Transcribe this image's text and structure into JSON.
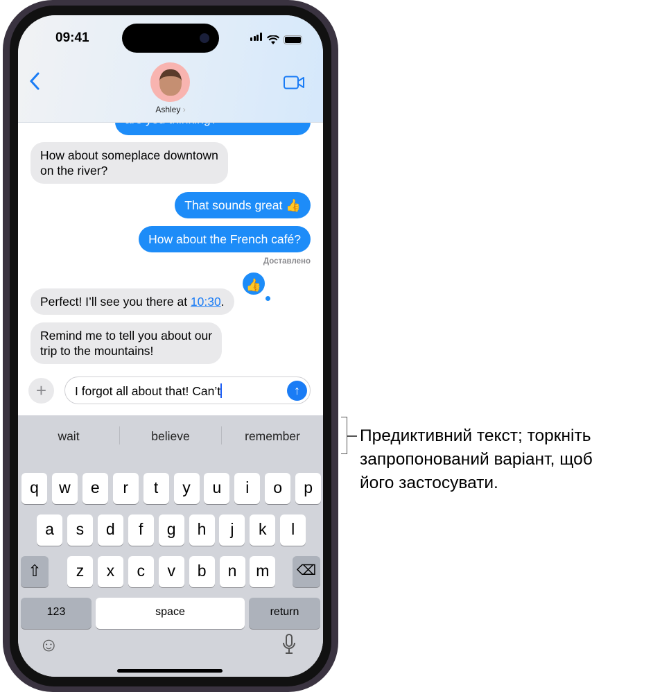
{
  "status_bar": {
    "time": "09:41"
  },
  "header": {
    "contact_name": "Ashley",
    "back_icon": "chevron-left-icon",
    "video_icon": "video-camera-icon"
  },
  "messages": [
    {
      "side": "out",
      "text": "are you thinking?"
    },
    {
      "side": "in",
      "lines": [
        "How about someplace downtown",
        "on the river?"
      ]
    },
    {
      "side": "out",
      "text": "That sounds great 👍"
    },
    {
      "side": "out",
      "text": "How about the French café?"
    },
    {
      "side": "in",
      "text_before": "Perfect! I’ll see you there at ",
      "link": "10:30",
      "text_after": "."
    },
    {
      "side": "in",
      "lines": [
        "Remind me to tell you about our",
        "trip to the mountains!"
      ]
    }
  ],
  "delivered_label": "Доставлено",
  "tapback": "👍",
  "compose": {
    "value": "I forgot all about that! Can’t"
  },
  "keyboard": {
    "predictions": [
      "wait",
      "believe",
      "remember"
    ],
    "row1": [
      "q",
      "w",
      "e",
      "r",
      "t",
      "y",
      "u",
      "i",
      "o",
      "p"
    ],
    "row2": [
      "a",
      "s",
      "d",
      "f",
      "g",
      "h",
      "j",
      "k",
      "l"
    ],
    "row3": [
      "z",
      "x",
      "c",
      "v",
      "b",
      "n",
      "m"
    ],
    "numbers_label": "123",
    "space_label": "space",
    "return_label": "return"
  },
  "callout": {
    "lines": [
      "Предиктивний текст; торкніть",
      "запропонований варіант, щоб",
      "його застосувати."
    ]
  },
  "colors": {
    "accent": "#1d8cf8",
    "incoming_bubble": "#e9e9eb",
    "keyboard_bg": "#d2d4da"
  }
}
